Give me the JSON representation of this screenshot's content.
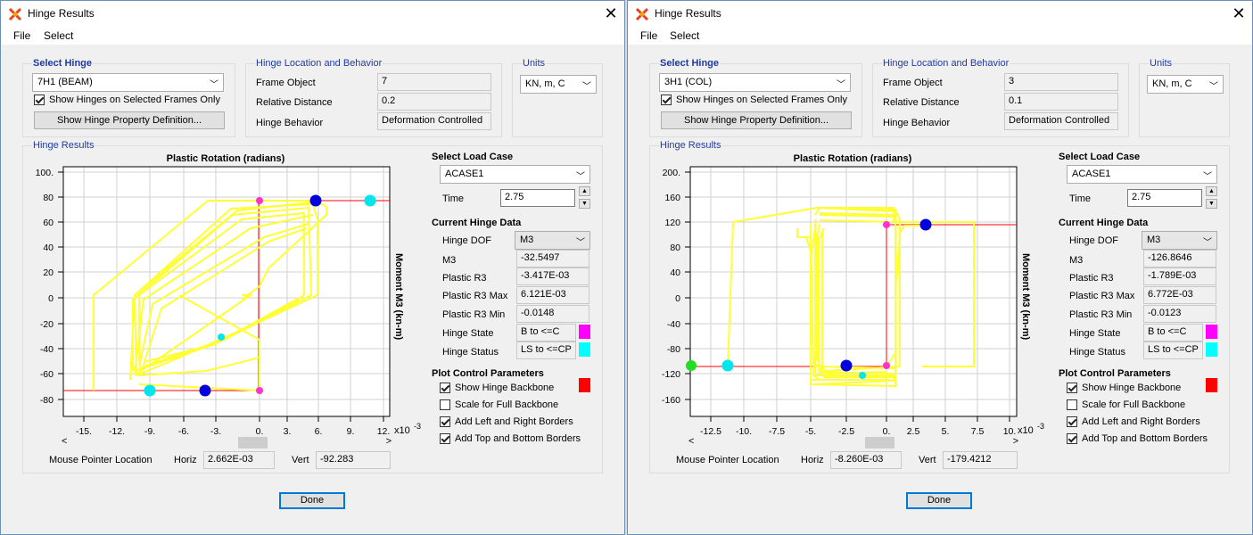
{
  "windows": [
    {
      "title": "Hinge Results",
      "menu": [
        "File",
        "Select"
      ],
      "select_hinge": {
        "title": "Select Hinge",
        "hinge": "7H1 (BEAM)",
        "show_selected_label": "Show Hinges on Selected Frames Only",
        "show_selected_checked": true,
        "show_property_button": "Show Hinge Property Definition..."
      },
      "location": {
        "title": "Hinge Location and Behavior",
        "frame_object_label": "Frame Object",
        "frame_object": "7",
        "relative_distance_label": "Relative Distance",
        "relative_distance": "0.2",
        "hinge_behavior_label": "Hinge Behavior",
        "hinge_behavior": "Deformation Controlled"
      },
      "units": {
        "title": "Units",
        "value": "KN, m, C"
      },
      "results": {
        "title": "Hinge Results",
        "plot_title": "Plastic Rotation  (radians)",
        "y_axis_label": "Moment M3  (kn-m)",
        "x_exponent": "x10",
        "x_exponent_power": "-3",
        "x_ticks": [
          "-15.",
          "-12.",
          "-9.",
          "-6.",
          "-3.",
          "0.",
          "3.",
          "6.",
          "9.",
          "12."
        ],
        "y_ticks": [
          "100.",
          "80",
          "60",
          "40",
          "20",
          "0",
          "-20",
          "-40",
          "-60",
          "-80"
        ],
        "mouse_label": "Mouse Pointer Location",
        "horiz_label": "Horiz",
        "horiz": "2.662E-03",
        "vert_label": "Vert",
        "vert": "-92.283"
      },
      "load_case": {
        "title": "Select Load Case",
        "value": "ACASE1",
        "time_label": "Time",
        "time": "2.75"
      },
      "hinge_data": {
        "title": "Current Hinge Data",
        "dof_label": "Hinge DOF",
        "dof": "M3",
        "m3_label": "M3",
        "m3": "-32.5497",
        "pr3_label": "Plastic R3",
        "pr3": "-3.417E-03",
        "pr3max_label": "Plastic R3 Max",
        "pr3max": "6.121E-03",
        "pr3min_label": "Plastic R3 Min",
        "pr3min": "-0.0148",
        "state_label": "Hinge State",
        "state": "B to <=C",
        "state_color": "#ff00ff",
        "status_label": "Hinge Status",
        "status": "LS to <=CP",
        "status_color": "#00ffff"
      },
      "plot_control": {
        "title": "Plot Control Parameters",
        "backbone_label": "Show Hinge Backbone",
        "backbone_checked": true,
        "backbone_color": "#ff0000",
        "scale_label": "Scale for Full Backbone",
        "scale_checked": false,
        "lr_label": "Add Left and Right Borders",
        "lr_checked": true,
        "tb_label": "Add Top and Bottom Borders",
        "tb_checked": true
      },
      "done_label": "Done"
    },
    {
      "title": "Hinge Results",
      "menu": [
        "File",
        "Select"
      ],
      "select_hinge": {
        "title": "Select Hinge",
        "hinge": "3H1 (COL)",
        "show_selected_label": "Show Hinges on Selected Frames Only",
        "show_selected_checked": true,
        "show_property_button": "Show Hinge Property Definition..."
      },
      "location": {
        "title": "Hinge Location and Behavior",
        "frame_object_label": "Frame Object",
        "frame_object": "3",
        "relative_distance_label": "Relative Distance",
        "relative_distance": "0.1",
        "hinge_behavior_label": "Hinge Behavior",
        "hinge_behavior": "Deformation Controlled"
      },
      "units": {
        "title": "Units",
        "value": "KN, m, C"
      },
      "results": {
        "title": "Hinge Results",
        "plot_title": "Plastic Rotation  (radians)",
        "y_axis_label": "Moment M3  (kn-m)",
        "x_exponent": "x10",
        "x_exponent_power": "-3",
        "x_ticks": [
          "-12.5",
          "-10.",
          "-7.5",
          "-5.",
          "-2.5",
          "0.",
          "2.5",
          "5.",
          "7.5",
          "10."
        ],
        "y_ticks": [
          "200.",
          "160",
          "120",
          "80",
          "40",
          "0",
          "-40",
          "-80",
          "-120",
          "-160"
        ],
        "mouse_label": "Mouse Pointer Location",
        "horiz_label": "Horiz",
        "horiz": "-8.260E-03",
        "vert_label": "Vert",
        "vert": "-179.4212"
      },
      "load_case": {
        "title": "Select Load Case",
        "value": "ACASE1",
        "time_label": "Time",
        "time": "2.75"
      },
      "hinge_data": {
        "title": "Current Hinge Data",
        "dof_label": "Hinge DOF",
        "dof": "M3",
        "m3_label": "M3",
        "m3": "-126.8646",
        "pr3_label": "Plastic R3",
        "pr3": "-1.789E-03",
        "pr3max_label": "Plastic R3 Max",
        "pr3max": "6.772E-03",
        "pr3min_label": "Plastic R3 Min",
        "pr3min": "-0.0123",
        "state_label": "Hinge State",
        "state": "B to <=C",
        "state_color": "#ff00ff",
        "status_label": "Hinge Status",
        "status": "LS to <=CP",
        "status_color": "#00ffff"
      },
      "plot_control": {
        "title": "Plot Control Parameters",
        "backbone_label": "Show Hinge Backbone",
        "backbone_checked": true,
        "backbone_color": "#ff0000",
        "scale_label": "Scale for Full Backbone",
        "scale_checked": false,
        "lr_label": "Add Left and Right Borders",
        "lr_checked": true,
        "tb_label": "Add Top and Bottom Borders",
        "tb_checked": true
      },
      "done_label": "Done"
    }
  ]
}
